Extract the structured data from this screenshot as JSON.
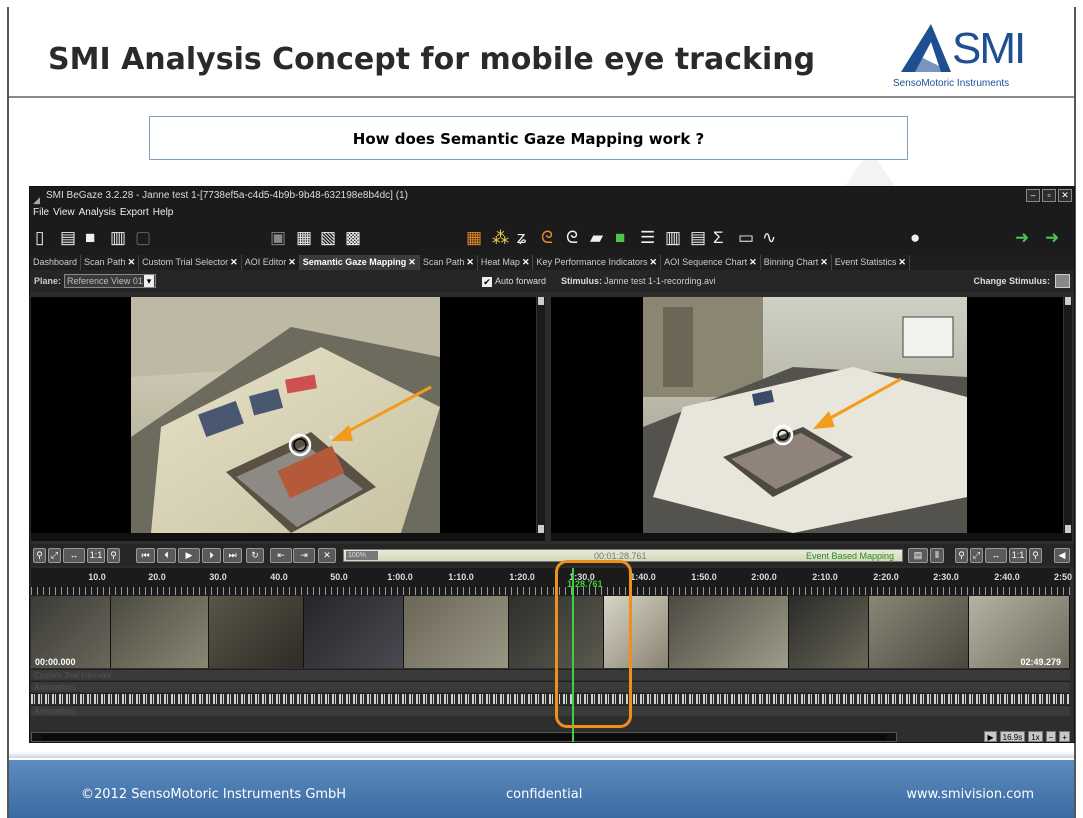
{
  "slide": {
    "title": "SMI Analysis Concept for mobile eye tracking",
    "logo_text": "SMI",
    "logo_subtitle": "SensoMotoric Instruments",
    "question": "How does Semantic Gaze Mapping work ?",
    "footer": {
      "copyright": "©2012 SensoMotoric Instruments GmbH",
      "confidential": "confidential",
      "website": "www.smivision.com"
    }
  },
  "app": {
    "window_title": "SMI BeGaze 3.2.28 - Janne test 1-[7738ef5a-c4d5-4b9b-9b48-632198e8b4dc] (1)",
    "menu": [
      "File",
      "View",
      "Analysis",
      "Export",
      "Help"
    ],
    "tabs": [
      {
        "label": "Dashboard",
        "active": false
      },
      {
        "label": "Scan Path",
        "active": false
      },
      {
        "label": "Custom Trial Selector",
        "active": false
      },
      {
        "label": "AOI Editor",
        "active": false
      },
      {
        "label": "Semantic Gaze Mapping",
        "active": true
      },
      {
        "label": "Scan Path",
        "active": false
      },
      {
        "label": "Heat Map",
        "active": false
      },
      {
        "label": "Key Performance Indicators",
        "active": false
      },
      {
        "label": "AOI Sequence Chart",
        "active": false
      },
      {
        "label": "Binning Chart",
        "active": false
      },
      {
        "label": "Event Statistics",
        "active": false
      }
    ],
    "plane_label": "Plane:",
    "plane_value": "Reference View 01",
    "auto_forward_label": "Auto forward",
    "auto_forward_checked": true,
    "stimulus_label": "Stimulus:",
    "stimulus_value": "Janne test 1-1-recording.avi",
    "change_stimulus_label": "Change Stimulus:",
    "zoom_level": "100%",
    "current_time": "00:01:28.761",
    "mapping_mode": "Event Based Mapping",
    "ruler_ticks": [
      "10.0",
      "20.0",
      "30.0",
      "40.0",
      "50.0",
      "1:00.0",
      "1:10.0",
      "1:20.0",
      "1:30.0",
      "1:40.0",
      "1:50.0",
      "2:00.0",
      "2:10.0",
      "2:20.0",
      "2:30.0",
      "2:40.0",
      "2:50"
    ],
    "playhead_time": "1:28.761",
    "timeline_start": "00:00.000",
    "timeline_end": "02:49.279",
    "tracks": [
      "Custom Trial Intervals",
      "Annotations",
      "",
      "Annotations"
    ],
    "zoom_window": "16.9s",
    "speed": "1x"
  },
  "colors": {
    "accent_orange": "#f0901c",
    "playhead_green": "#3cd23c",
    "footer_blue": "#3a6aa3",
    "logo_blue": "#1d4f91"
  }
}
